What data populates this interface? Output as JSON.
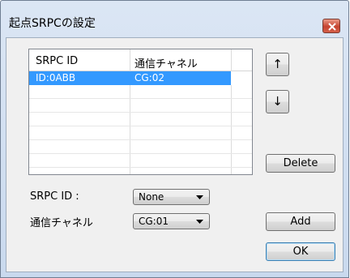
{
  "window": {
    "title": "起点SRPCの設定",
    "close_icon": "close-icon"
  },
  "list": {
    "headers": [
      "SRPC ID",
      "通信チャネル"
    ],
    "rows": [
      {
        "id": "ID:0ABB",
        "channel": "CG:02",
        "selected": true
      }
    ]
  },
  "buttons": {
    "up": "↑",
    "down": "↓",
    "delete": "Delete",
    "add": "Add",
    "ok": "OK"
  },
  "form": {
    "srpc_label": "SRPC ID :",
    "srpc_value": "None",
    "channel_label": "通信チャネル",
    "channel_value": "CG:01"
  },
  "colors": {
    "selection": "#3399ff",
    "close_button": "#c6442f"
  }
}
